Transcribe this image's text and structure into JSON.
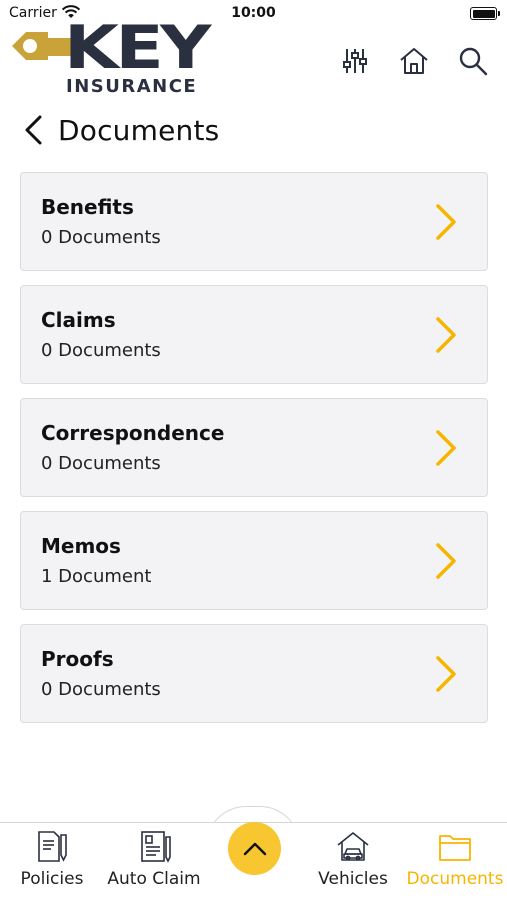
{
  "status_bar": {
    "carrier": "Carrier",
    "time": "10:00"
  },
  "brand": {
    "name": "KEY",
    "subtitle": "INSURANCE",
    "key_color": "#c9a23a",
    "text_color": "#2b3040"
  },
  "header": {
    "icons": [
      "sliders-icon",
      "home-icon",
      "search-icon"
    ]
  },
  "page": {
    "title": "Documents"
  },
  "colors": {
    "accent": "#f7b500",
    "fab": "#f7c630",
    "card_bg": "#f3f3f5"
  },
  "categories": [
    {
      "title": "Benefits",
      "count": "0 Documents"
    },
    {
      "title": "Claims",
      "count": "0 Documents"
    },
    {
      "title": "Correspondence",
      "count": "0 Documents"
    },
    {
      "title": "Memos",
      "count": "1 Document"
    },
    {
      "title": "Proofs",
      "count": "0 Documents"
    }
  ],
  "bottom_nav": {
    "items": [
      {
        "label": "Policies",
        "icon": "policy-document-icon",
        "active": false
      },
      {
        "label": "Auto Claim",
        "icon": "claim-form-icon",
        "active": false
      },
      {
        "label": "Vehicles",
        "icon": "garage-car-icon",
        "active": false
      },
      {
        "label": "Documents",
        "icon": "folder-icon",
        "active": true
      }
    ],
    "center_button_icon": "chevron-up-icon"
  }
}
